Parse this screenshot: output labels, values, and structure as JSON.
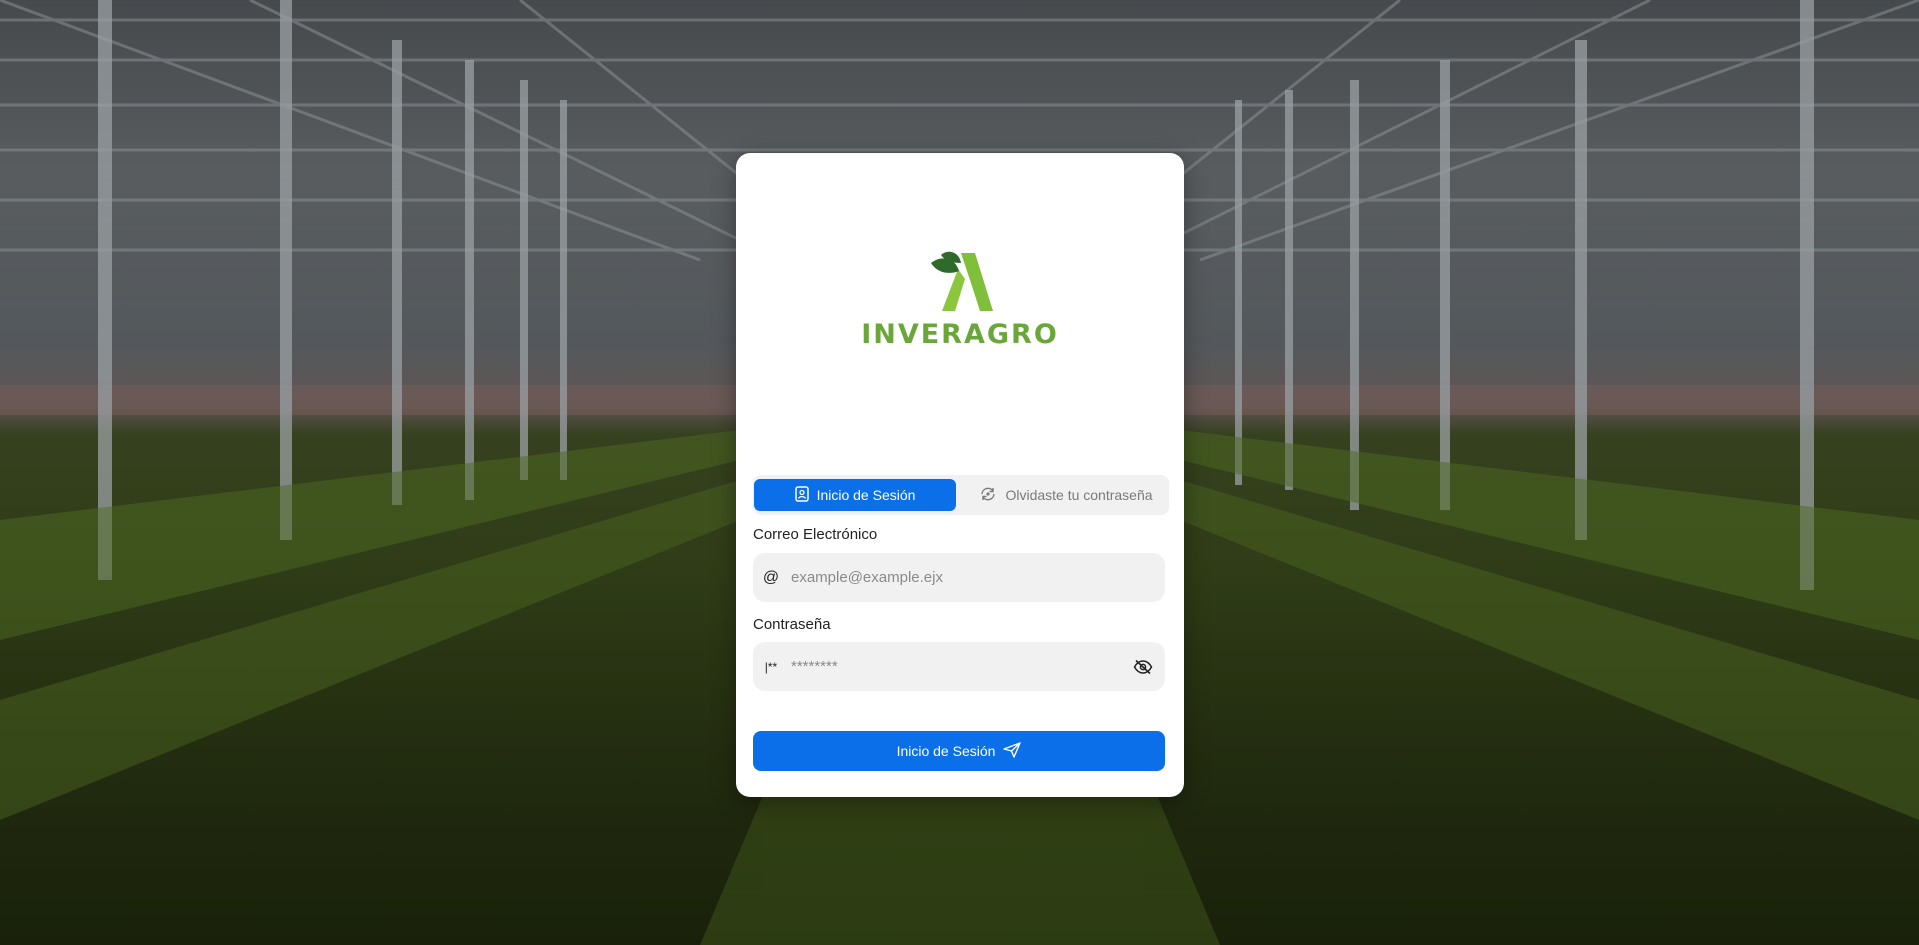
{
  "brand": {
    "name": "INVERAGRO",
    "colors": {
      "leaf_dark": "#2f6a2a",
      "leaf_light": "#8cc63f",
      "text": "#6aa63a"
    }
  },
  "tabs": [
    {
      "label": "Inicio de Sesión",
      "icon": "id-badge-icon",
      "active": true
    },
    {
      "label": "Olvidaste tu contraseña",
      "icon": "refresh-lock-icon",
      "active": false
    }
  ],
  "form": {
    "email": {
      "label": "Correo Electrónico",
      "placeholder": "example@example.ejx",
      "icon": "at-sign-icon",
      "value": ""
    },
    "password": {
      "label": "Contraseña",
      "placeholder": "********",
      "icon": "password-icon",
      "icon_text": "|**",
      "value": "",
      "toggle_icon": "eye-off-icon"
    },
    "submit": {
      "label": "Inicio de Sesión",
      "icon": "send-icon"
    }
  },
  "accent": "#0a6fe8",
  "background": "greenhouse-photo"
}
